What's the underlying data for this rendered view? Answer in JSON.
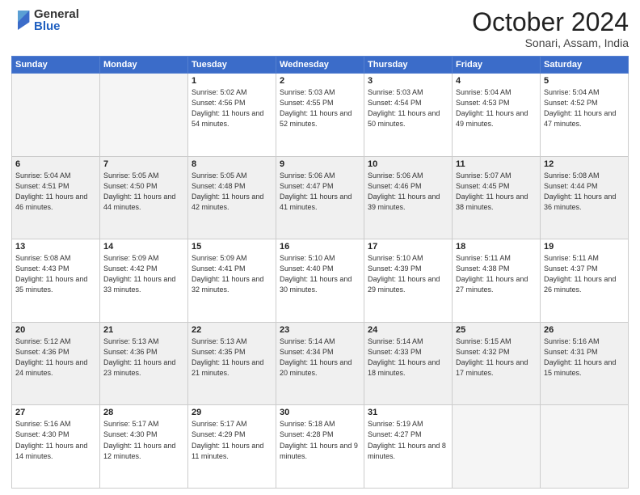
{
  "header": {
    "logo_general": "General",
    "logo_blue": "Blue",
    "month_title": "October 2024",
    "subtitle": "Sonari, Assam, India"
  },
  "weekdays": [
    "Sunday",
    "Monday",
    "Tuesday",
    "Wednesday",
    "Thursday",
    "Friday",
    "Saturday"
  ],
  "weeks": [
    [
      {
        "day": null
      },
      {
        "day": null
      },
      {
        "day": "1",
        "sunrise": "5:02 AM",
        "sunset": "4:56 PM",
        "daylight": "11 hours and 54 minutes."
      },
      {
        "day": "2",
        "sunrise": "5:03 AM",
        "sunset": "4:55 PM",
        "daylight": "11 hours and 52 minutes."
      },
      {
        "day": "3",
        "sunrise": "5:03 AM",
        "sunset": "4:54 PM",
        "daylight": "11 hours and 50 minutes."
      },
      {
        "day": "4",
        "sunrise": "5:04 AM",
        "sunset": "4:53 PM",
        "daylight": "11 hours and 49 minutes."
      },
      {
        "day": "5",
        "sunrise": "5:04 AM",
        "sunset": "4:52 PM",
        "daylight": "11 hours and 47 minutes."
      }
    ],
    [
      {
        "day": "6",
        "sunrise": "5:04 AM",
        "sunset": "4:51 PM",
        "daylight": "11 hours and 46 minutes."
      },
      {
        "day": "7",
        "sunrise": "5:05 AM",
        "sunset": "4:50 PM",
        "daylight": "11 hours and 44 minutes."
      },
      {
        "day": "8",
        "sunrise": "5:05 AM",
        "sunset": "4:48 PM",
        "daylight": "11 hours and 42 minutes."
      },
      {
        "day": "9",
        "sunrise": "5:06 AM",
        "sunset": "4:47 PM",
        "daylight": "11 hours and 41 minutes."
      },
      {
        "day": "10",
        "sunrise": "5:06 AM",
        "sunset": "4:46 PM",
        "daylight": "11 hours and 39 minutes."
      },
      {
        "day": "11",
        "sunrise": "5:07 AM",
        "sunset": "4:45 PM",
        "daylight": "11 hours and 38 minutes."
      },
      {
        "day": "12",
        "sunrise": "5:08 AM",
        "sunset": "4:44 PM",
        "daylight": "11 hours and 36 minutes."
      }
    ],
    [
      {
        "day": "13",
        "sunrise": "5:08 AM",
        "sunset": "4:43 PM",
        "daylight": "11 hours and 35 minutes."
      },
      {
        "day": "14",
        "sunrise": "5:09 AM",
        "sunset": "4:42 PM",
        "daylight": "11 hours and 33 minutes."
      },
      {
        "day": "15",
        "sunrise": "5:09 AM",
        "sunset": "4:41 PM",
        "daylight": "11 hours and 32 minutes."
      },
      {
        "day": "16",
        "sunrise": "5:10 AM",
        "sunset": "4:40 PM",
        "daylight": "11 hours and 30 minutes."
      },
      {
        "day": "17",
        "sunrise": "5:10 AM",
        "sunset": "4:39 PM",
        "daylight": "11 hours and 29 minutes."
      },
      {
        "day": "18",
        "sunrise": "5:11 AM",
        "sunset": "4:38 PM",
        "daylight": "11 hours and 27 minutes."
      },
      {
        "day": "19",
        "sunrise": "5:11 AM",
        "sunset": "4:37 PM",
        "daylight": "11 hours and 26 minutes."
      }
    ],
    [
      {
        "day": "20",
        "sunrise": "5:12 AM",
        "sunset": "4:36 PM",
        "daylight": "11 hours and 24 minutes."
      },
      {
        "day": "21",
        "sunrise": "5:13 AM",
        "sunset": "4:36 PM",
        "daylight": "11 hours and 23 minutes."
      },
      {
        "day": "22",
        "sunrise": "5:13 AM",
        "sunset": "4:35 PM",
        "daylight": "11 hours and 21 minutes."
      },
      {
        "day": "23",
        "sunrise": "5:14 AM",
        "sunset": "4:34 PM",
        "daylight": "11 hours and 20 minutes."
      },
      {
        "day": "24",
        "sunrise": "5:14 AM",
        "sunset": "4:33 PM",
        "daylight": "11 hours and 18 minutes."
      },
      {
        "day": "25",
        "sunrise": "5:15 AM",
        "sunset": "4:32 PM",
        "daylight": "11 hours and 17 minutes."
      },
      {
        "day": "26",
        "sunrise": "5:16 AM",
        "sunset": "4:31 PM",
        "daylight": "11 hours and 15 minutes."
      }
    ],
    [
      {
        "day": "27",
        "sunrise": "5:16 AM",
        "sunset": "4:30 PM",
        "daylight": "11 hours and 14 minutes."
      },
      {
        "day": "28",
        "sunrise": "5:17 AM",
        "sunset": "4:30 PM",
        "daylight": "11 hours and 12 minutes."
      },
      {
        "day": "29",
        "sunrise": "5:17 AM",
        "sunset": "4:29 PM",
        "daylight": "11 hours and 11 minutes."
      },
      {
        "day": "30",
        "sunrise": "5:18 AM",
        "sunset": "4:28 PM",
        "daylight": "11 hours and 9 minutes."
      },
      {
        "day": "31",
        "sunrise": "5:19 AM",
        "sunset": "4:27 PM",
        "daylight": "11 hours and 8 minutes."
      },
      {
        "day": null
      },
      {
        "day": null
      }
    ]
  ]
}
